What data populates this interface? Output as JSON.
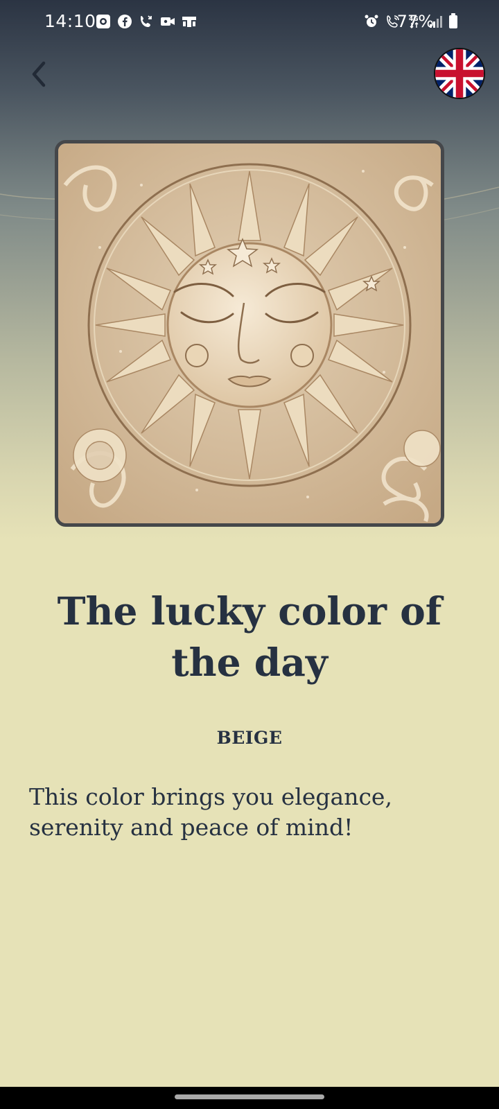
{
  "status_bar": {
    "time": "14:10",
    "battery_percent": "77%",
    "left_icons": [
      "screen-record-icon",
      "facebook-icon",
      "wifi-call-icon",
      "video-call-icon",
      "cast-icon"
    ],
    "right_icons": [
      "alarm-icon",
      "volte-call-icon",
      "network-4g-icon",
      "signal-icon"
    ]
  },
  "header": {
    "back_icon": "chevron-left-icon",
    "language_flag": "uk-flag-icon"
  },
  "card": {
    "image": "sun-face-illustration"
  },
  "content": {
    "title": "The lucky color of the day",
    "color_name": "BEIGE",
    "description": "This color brings you elegance, serenity and peace of mind!"
  },
  "colors": {
    "text": "#263141",
    "background": "#e6e2b7",
    "header_top": "#2b3443",
    "card_border": "#45474a",
    "card_fill": "#d6bea0"
  }
}
